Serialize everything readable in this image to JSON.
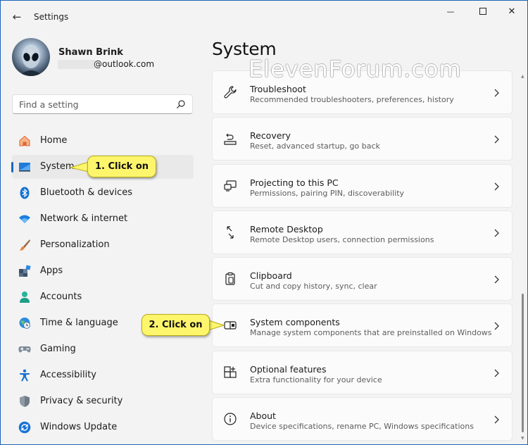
{
  "window": {
    "title": "Settings",
    "back_glyph": "←",
    "min_glyph": "—",
    "close_glyph": "✕"
  },
  "profile": {
    "name": "Shawn Brink",
    "email": "@outlook.com"
  },
  "search": {
    "placeholder": "Find a setting"
  },
  "nav": {
    "items": [
      {
        "label": "Home",
        "icon": "home-icon"
      },
      {
        "label": "System",
        "icon": "monitor-icon",
        "active": true
      },
      {
        "label": "Bluetooth & devices",
        "icon": "bluetooth-icon"
      },
      {
        "label": "Network & internet",
        "icon": "wifi-icon"
      },
      {
        "label": "Personalization",
        "icon": "paintbrush-icon"
      },
      {
        "label": "Apps",
        "icon": "apps-icon"
      },
      {
        "label": "Accounts",
        "icon": "person-icon"
      },
      {
        "label": "Time & language",
        "icon": "globe-clock-icon"
      },
      {
        "label": "Gaming",
        "icon": "gamepad-icon"
      },
      {
        "label": "Accessibility",
        "icon": "accessibility-icon"
      },
      {
        "label": "Privacy & security",
        "icon": "shield-icon"
      },
      {
        "label": "Windows Update",
        "icon": "sync-icon"
      }
    ]
  },
  "main": {
    "page_title": "System",
    "watermark": "ElevenForum.com",
    "cards": [
      {
        "title": "Troubleshoot",
        "desc": "Recommended troubleshooters, preferences, history",
        "icon": "wrench-icon"
      },
      {
        "title": "Recovery",
        "desc": "Reset, advanced startup, go back",
        "icon": "recovery-icon"
      },
      {
        "title": "Projecting to this PC",
        "desc": "Permissions, pairing PIN, discoverability",
        "icon": "projector-icon"
      },
      {
        "title": "Remote Desktop",
        "desc": "Remote Desktop users, connection permissions",
        "icon": "remote-desktop-icon"
      },
      {
        "title": "Clipboard",
        "desc": "Cut and copy history, sync, clear",
        "icon": "clipboard-icon"
      },
      {
        "title": "System components",
        "desc": "Manage system components that are preinstalled on Windows",
        "icon": "system-components-icon"
      },
      {
        "title": "Optional features",
        "desc": "Extra functionality for your device",
        "icon": "optional-features-icon"
      },
      {
        "title": "About",
        "desc": "Device specifications, rename PC, Windows specifications",
        "icon": "info-icon"
      }
    ]
  },
  "scrollbar": {
    "up_glyph": "▲",
    "down_glyph": "▼"
  },
  "callouts": {
    "step1": "1. Click on",
    "step2": "2. Click on"
  },
  "colors": {
    "accent": "#1a67c0",
    "callout_fill": "#fdf66c",
    "window_border": "#1c63b8"
  }
}
